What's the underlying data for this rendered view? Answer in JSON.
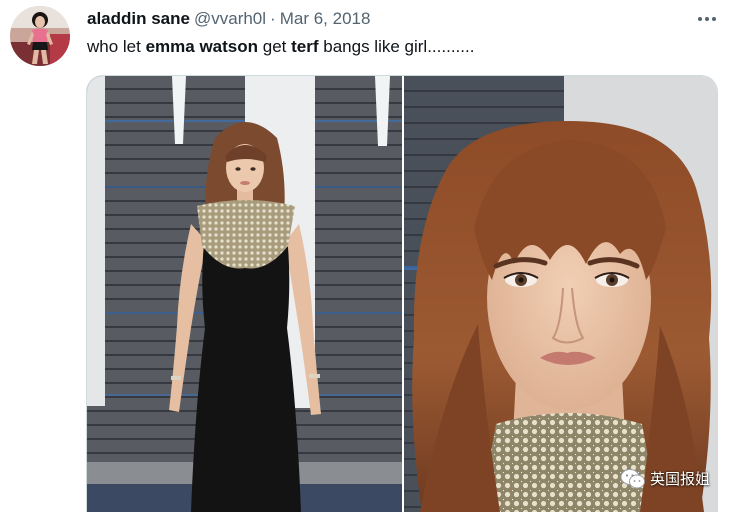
{
  "tweet": {
    "author_name": "aladdin sane",
    "handle": "@vvarh0l",
    "separator": "·",
    "date": "Mar 6, 2018",
    "text_parts": [
      "who let ",
      "emma watson",
      " get ",
      "terf",
      " bangs like girl.........."
    ]
  },
  "icons": {
    "more": "more-horizontal-icon",
    "watermark": "wechat-icon"
  },
  "watermark": {
    "text": "英国报姐"
  },
  "colors": {
    "primary_text": "#0f1419",
    "secondary_text": "#536471",
    "media_border": "#cfd9de"
  }
}
